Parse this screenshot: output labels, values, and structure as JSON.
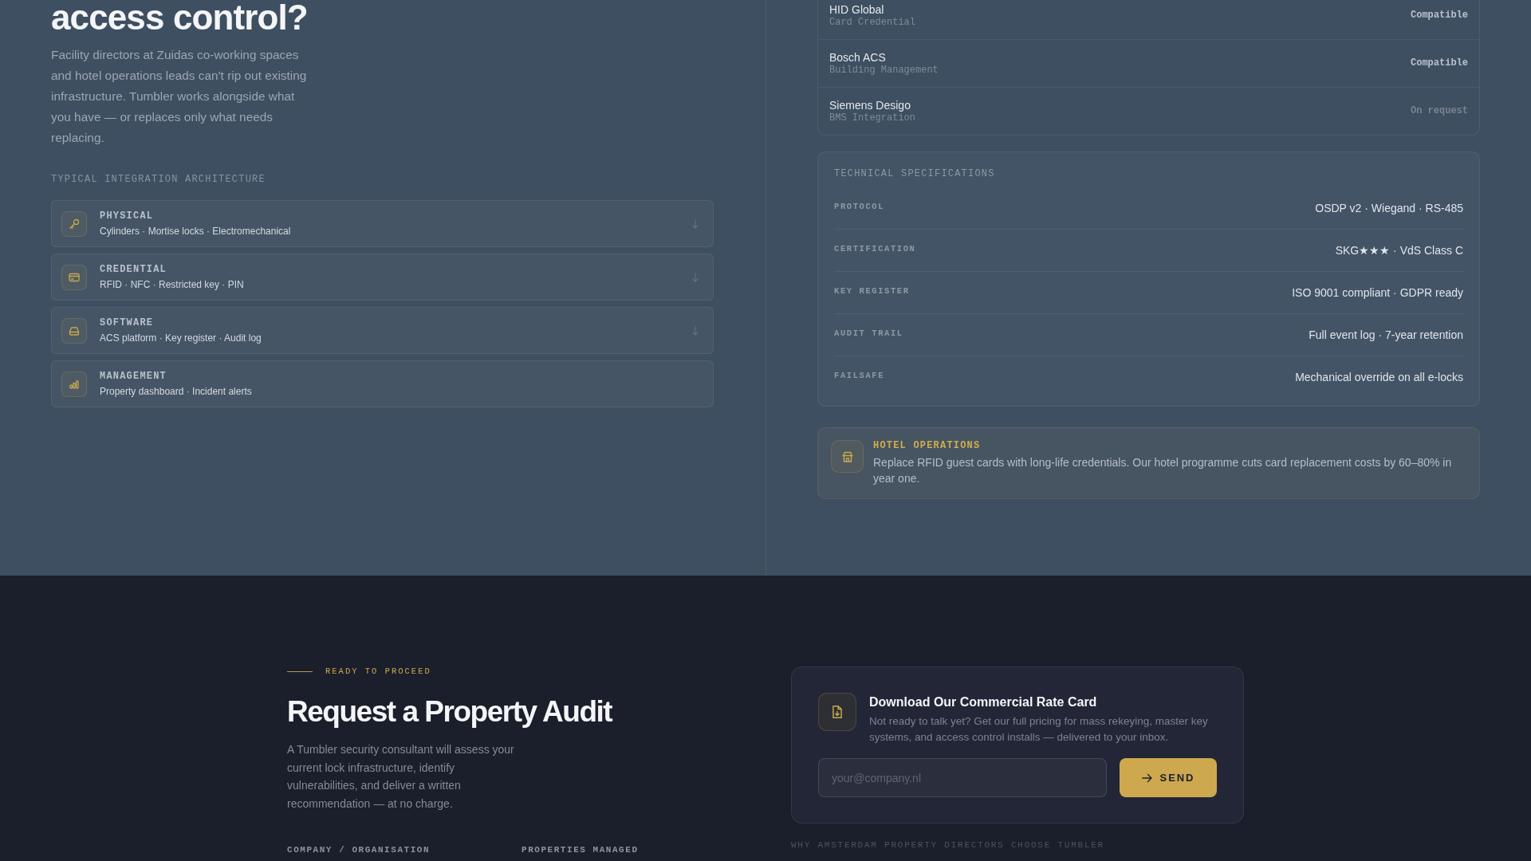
{
  "intro": {
    "heading": "access control?",
    "body": "Facility directors at Zuidas co-working spaces and hotel operations leads can't rip out existing infrastructure. Tumbler works alongside what you have — or replaces only what needs replacing."
  },
  "architecture": {
    "title": "TYPICAL INTEGRATION ARCHITECTURE",
    "layers": [
      {
        "kind": "physical",
        "name": "PHYSICAL",
        "items": "Cylinders · Mortise locks · Electromechanical",
        "next_arrow": true
      },
      {
        "kind": "credential",
        "name": "CREDENTIAL",
        "items": "RFID · NFC · Restricted key · PIN",
        "next_arrow": true
      },
      {
        "kind": "software",
        "name": "SOFTWARE",
        "items": "ACS platform · Key register · Audit log",
        "next_arrow": true
      },
      {
        "kind": "management",
        "name": "MANAGEMENT",
        "items": "Property dashboard · Incident alerts",
        "next_arrow": false
      }
    ]
  },
  "compatibility": [
    {
      "name": "HID Global",
      "type": "Card Credential",
      "status": "Compatible",
      "confirmed": true
    },
    {
      "name": "Bosch ACS",
      "type": "Building Management",
      "status": "Compatible",
      "confirmed": true
    },
    {
      "name": "Siemens Desigo",
      "type": "BMS Integration",
      "status": "On request",
      "confirmed": false
    }
  ],
  "specs": {
    "title": "TECHNICAL SPECIFICATIONS",
    "rows": [
      {
        "label": "PROTOCOL",
        "value": "OSDP v2 · Wiegand · RS-485"
      },
      {
        "label": "CERTIFICATION",
        "value": "SKG★★★ · VdS Class C"
      },
      {
        "label": "KEY REGISTER",
        "value": "ISO 9001 compliant · GDPR ready"
      },
      {
        "label": "AUDIT TRAIL",
        "value": "Full event log · 7-year retention"
      },
      {
        "label": "FAILSAFE",
        "value": "Mechanical override on all e-locks"
      }
    ]
  },
  "callout": {
    "title": "HOTEL OPERATIONS",
    "body": "Replace RFID guest cards with long-life credentials. Our hotel programme cuts card replacement costs by 60–80% in year one."
  },
  "audit": {
    "eyebrow": "READY TO PROCEED",
    "heading": "Request a Property Audit",
    "body": "A Tumbler security consultant will assess your current lock infrastructure, identify vulnerabilities, and deliver a written recommendation — at no charge.",
    "fields": [
      {
        "label": "COMPANY / ORGANISATION"
      },
      {
        "label": "PROPERTIES MANAGED"
      }
    ]
  },
  "rate_card": {
    "title": "Download Our Commercial Rate Card",
    "body": "Not ready to talk yet? Get our full pricing for mass rekeying, master key systems, and access control installs — delivered to your inbox.",
    "email": {
      "placeholder": "your@company.nl"
    },
    "button": "SEND"
  },
  "next_section": {
    "eyebrow": "WHY AMSTERDAM PROPERTY DIRECTORS CHOOSE TUMBLER"
  }
}
